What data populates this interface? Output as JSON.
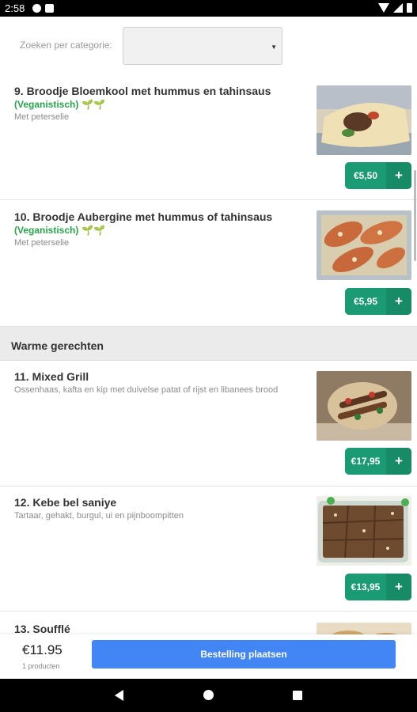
{
  "status": {
    "time": "2:58"
  },
  "filter": {
    "label": "Zoeken per categorie:"
  },
  "items": [
    {
      "title": "9. Broodje Bloemkool met hummus en tahinsaus",
      "tag": "(Veganistisch)",
      "sprout": "🌱🌱",
      "desc": "Met peterselie",
      "price": "€5,50",
      "plus": "+",
      "image": "wrap-photo"
    },
    {
      "title": "10. Broodje Aubergine met hummus of tahinsaus",
      "tag": "(Veganistisch)",
      "sprout": "🌱🌱",
      "desc": "Met peterselie",
      "price": "€5,95",
      "plus": "+",
      "image": "eggplant-photo"
    },
    {
      "title": "11. Mixed Grill",
      "desc": "Ossenhaas, kafta en kip met duivelse patat of rijst en libanees brood",
      "price": "€17,95",
      "plus": "+",
      "image": "grill-photo"
    },
    {
      "title": "12. Kebe bel saniye",
      "desc": "Tartaar, gehakt, burgul, ui en pijnboompitten",
      "price": "€13,95",
      "plus": "+",
      "image": "kebbeh-photo"
    },
    {
      "title": "13. Soufflé"
    }
  ],
  "section": {
    "title": "Warme gerechten"
  },
  "cart": {
    "total": "€11.95",
    "count": "1 producten",
    "order_label": "Bestelling plaatsen"
  }
}
